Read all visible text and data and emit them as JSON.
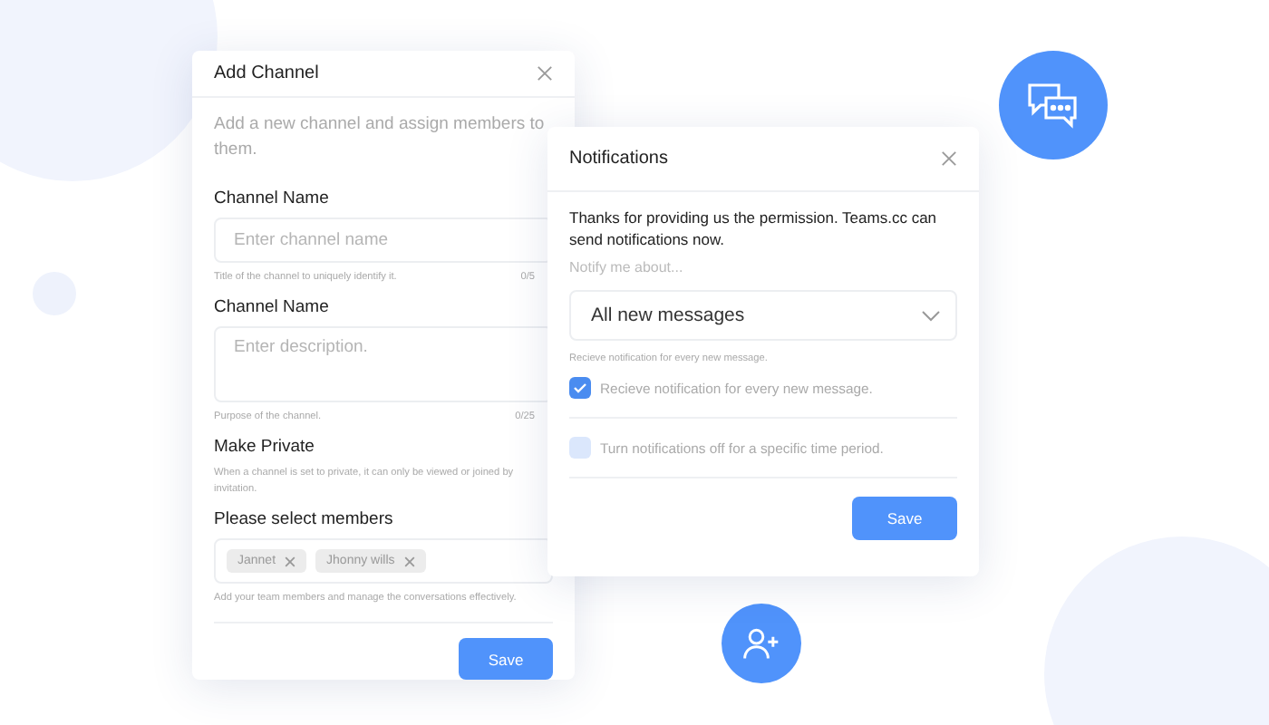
{
  "add_channel": {
    "title": "Add Channel",
    "description": "Add a new channel and assign members to them.",
    "fields": [
      {
        "kind": "input",
        "label": "Channel Name",
        "placeholder": "Enter channel name",
        "hint": "Title of the channel to uniquely identify it.",
        "counter": "0/5"
      },
      {
        "kind": "textarea",
        "label": "Channel Name",
        "placeholder": "Enter description.",
        "hint": "Purpose of the channel.",
        "counter": "0/25"
      },
      {
        "kind": "info",
        "label": "Make Private",
        "hint": "When a channel is set to private, it can only be viewed or joined by invitation."
      },
      {
        "kind": "members",
        "label": "Please select members",
        "members": [
          "Jannet",
          "Jhonny wills"
        ],
        "hint": "Add your team members and manage the conversations effectively."
      }
    ],
    "button": "Save"
  },
  "notifications": {
    "title": "Notifications",
    "message": "Thanks for providing us the permission. Teams.cc can send notifications now.",
    "prompt": "Notify me about...",
    "select_value": "All new messages",
    "select_hint": "Recieve notification for every new message.",
    "options": [
      {
        "label": "Recieve notification for every new message.",
        "checked": true
      },
      {
        "label": "Turn notifications off for a specific time period.",
        "checked": false
      }
    ],
    "button": "Save"
  }
}
